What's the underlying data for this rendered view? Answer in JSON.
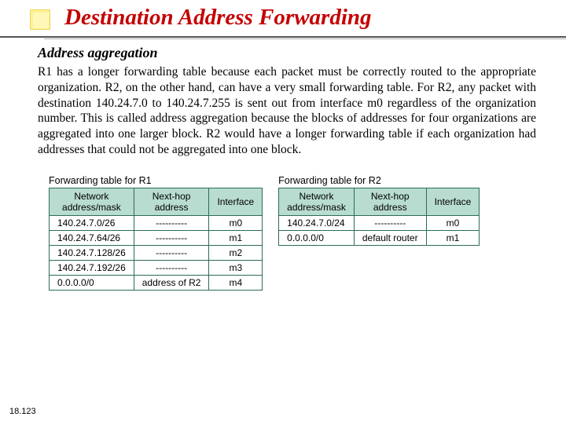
{
  "title": "Destination Address Forwarding",
  "subtitle": "Address aggregation",
  "paragraph": "R1 has a longer forwarding table because each packet must be correctly routed to the appropriate organization. R2, on the other hand, can have a very small forwarding table. For R2, any packet with destination 140.24.7.0 to 140.24.7.255 is sent out from interface m0 regardless of the organization number. This is called address aggregation because the blocks of addresses for four organizations are aggregated into one larger block. R2 would have a longer forwarding table if each organization had addresses that could not be aggregated into one block.",
  "tableR1": {
    "caption": "Forwarding table for R1",
    "headers": {
      "col1a": "Network",
      "col1b": "address/mask",
      "col2a": "Next-hop",
      "col2b": "address",
      "col3": "Interface"
    },
    "rows": [
      {
        "net": "140.24.7.0/26",
        "hop": "----------",
        "iface": "m0"
      },
      {
        "net": "140.24.7.64/26",
        "hop": "----------",
        "iface": "m1"
      },
      {
        "net": "140.24.7.128/26",
        "hop": "----------",
        "iface": "m2"
      },
      {
        "net": "140.24.7.192/26",
        "hop": "----------",
        "iface": "m3"
      },
      {
        "net": "0.0.0.0/0",
        "hop": "address of R2",
        "iface": "m4"
      }
    ]
  },
  "tableR2": {
    "caption": "Forwarding table for R2",
    "headers": {
      "col1a": "Network",
      "col1b": "address/mask",
      "col2a": "Next-hop",
      "col2b": "address",
      "col3": "Interface"
    },
    "rows": [
      {
        "net": "140.24.7.0/24",
        "hop": "----------",
        "iface": "m0"
      },
      {
        "net": "0.0.0.0/0",
        "hop": "default router",
        "iface": "m1"
      }
    ]
  },
  "pageNumber": "18.123"
}
